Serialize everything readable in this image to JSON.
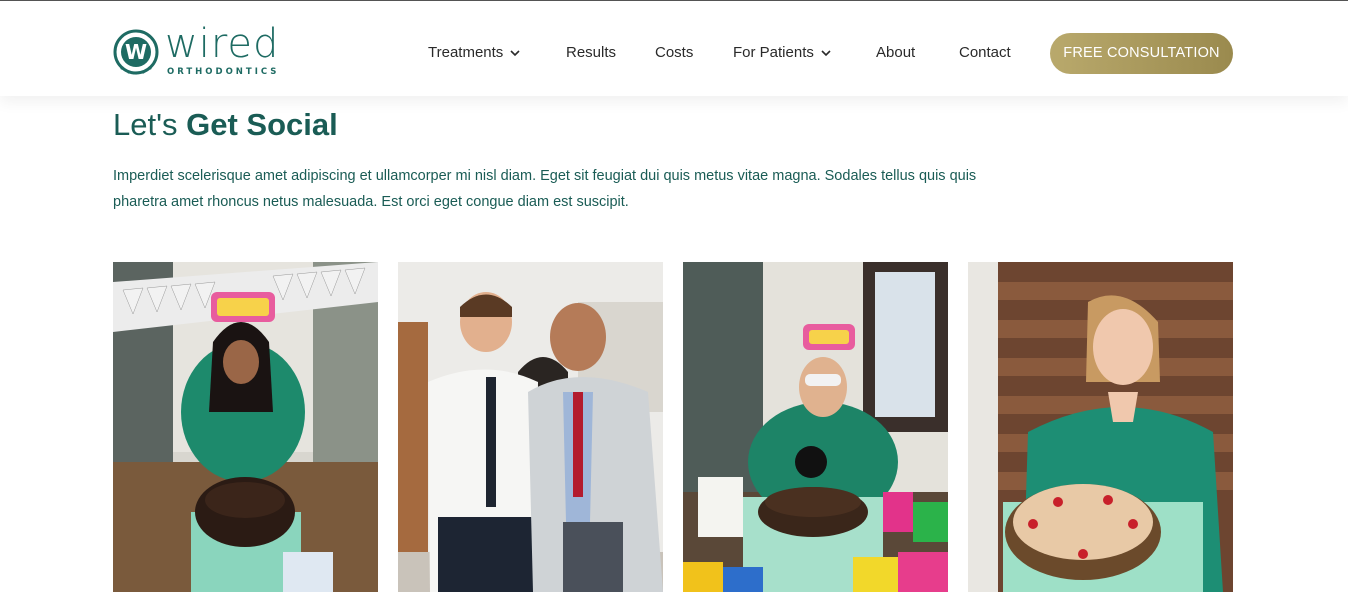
{
  "brand": {
    "name": "wired",
    "tagline": "ORTHODONTICS",
    "colors": {
      "primary": "#1a5c55",
      "accent": "#b0a062"
    }
  },
  "nav": {
    "items": [
      {
        "label": "Treatments",
        "has_dropdown": true
      },
      {
        "label": "Results",
        "has_dropdown": false
      },
      {
        "label": "Costs",
        "has_dropdown": false
      },
      {
        "label": "For Patients",
        "has_dropdown": true
      },
      {
        "label": "About",
        "has_dropdown": false
      },
      {
        "label": "Contact",
        "has_dropdown": false
      }
    ],
    "cta_label": "FREE CONSULTATION"
  },
  "social": {
    "title_prefix": "Let's ",
    "title_bold": "Get Social",
    "intro": "Imperdiet scelerisque amet adipiscing et ullamcorper mi nisl diam. Eget sit feugiat dui quis metus vitae magna. Sodales tellus quis quis pharetra amet rhoncus netus malesuada. Est orci eget congue diam est suscipit.",
    "photos": [
      {
        "subject": "staff-birthday-cake-photo"
      },
      {
        "subject": "patient-with-orthodontist-photo"
      },
      {
        "subject": "staff-birthday-party-photo"
      },
      {
        "subject": "staff-with-birthday-cake-photo"
      }
    ]
  }
}
